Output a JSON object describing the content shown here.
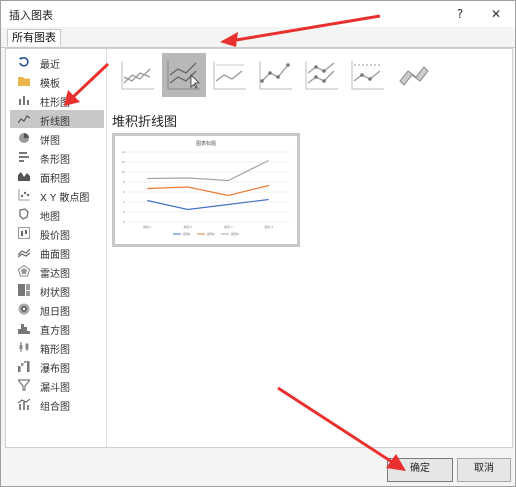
{
  "window": {
    "title": "插入图表",
    "help_label": "?",
    "close_label": "✕"
  },
  "tabs": [
    {
      "label": "所有图表"
    }
  ],
  "sidebar": {
    "items": [
      {
        "label": "最近",
        "icon": "recent-icon"
      },
      {
        "label": "模板",
        "icon": "template-folder-icon"
      },
      {
        "label": "柱形图",
        "icon": "column-chart-icon"
      },
      {
        "label": "折线图",
        "icon": "line-chart-icon",
        "selected": true
      },
      {
        "label": "饼图",
        "icon": "pie-chart-icon"
      },
      {
        "label": "条形图",
        "icon": "bar-chart-icon"
      },
      {
        "label": "面积图",
        "icon": "area-chart-icon"
      },
      {
        "label": "X Y 散点图",
        "icon": "scatter-chart-icon"
      },
      {
        "label": "地图",
        "icon": "map-chart-icon"
      },
      {
        "label": "股价图",
        "icon": "stock-chart-icon"
      },
      {
        "label": "曲面图",
        "icon": "surface-chart-icon"
      },
      {
        "label": "雷达图",
        "icon": "radar-chart-icon"
      },
      {
        "label": "树状图",
        "icon": "treemap-chart-icon"
      },
      {
        "label": "旭日图",
        "icon": "sunburst-chart-icon"
      },
      {
        "label": "直方图",
        "icon": "histogram-chart-icon"
      },
      {
        "label": "箱形图",
        "icon": "box-whisker-chart-icon"
      },
      {
        "label": "瀑布图",
        "icon": "waterfall-chart-icon"
      },
      {
        "label": "漏斗图",
        "icon": "funnel-chart-icon"
      },
      {
        "label": "组合图",
        "icon": "combo-chart-icon"
      }
    ]
  },
  "subtypes": [
    {
      "icon": "line-subtype-icon"
    },
    {
      "icon": "stacked-line-subtype-icon",
      "selected": true
    },
    {
      "icon": "percent-stacked-line-subtype-icon"
    },
    {
      "icon": "line-markers-subtype-icon"
    },
    {
      "icon": "stacked-line-markers-subtype-icon"
    },
    {
      "icon": "percent-stacked-line-markers-subtype-icon"
    },
    {
      "icon": "3d-line-subtype-icon"
    }
  ],
  "section": {
    "title": "堆积折线图"
  },
  "preview": {
    "chart_data": {
      "type": "line",
      "title": "图表标题",
      "categories": [
        "类别 1",
        "类别 2",
        "类别 3",
        "类别 4"
      ],
      "ylim": [
        0,
        14
      ],
      "yticks": [
        0,
        2,
        4,
        6,
        8,
        10,
        12,
        14
      ],
      "series": [
        {
          "name": "系列1",
          "values": [
            4.3,
            2.5,
            3.5,
            4.5
          ],
          "color": "#4472c4"
        },
        {
          "name": "系列2",
          "values": [
            6.7,
            7.0,
            5.3,
            7.3
          ],
          "color": "#ed7d31"
        },
        {
          "name": "系列3",
          "values": [
            8.7,
            8.8,
            8.3,
            12.3
          ],
          "color": "#a5a5a5"
        }
      ]
    }
  },
  "footer": {
    "ok_label": "确定",
    "cancel_label": "取消"
  },
  "colors": {
    "selected_bg": "#c8c8c8",
    "annotation_arrow": "#e8312f"
  }
}
